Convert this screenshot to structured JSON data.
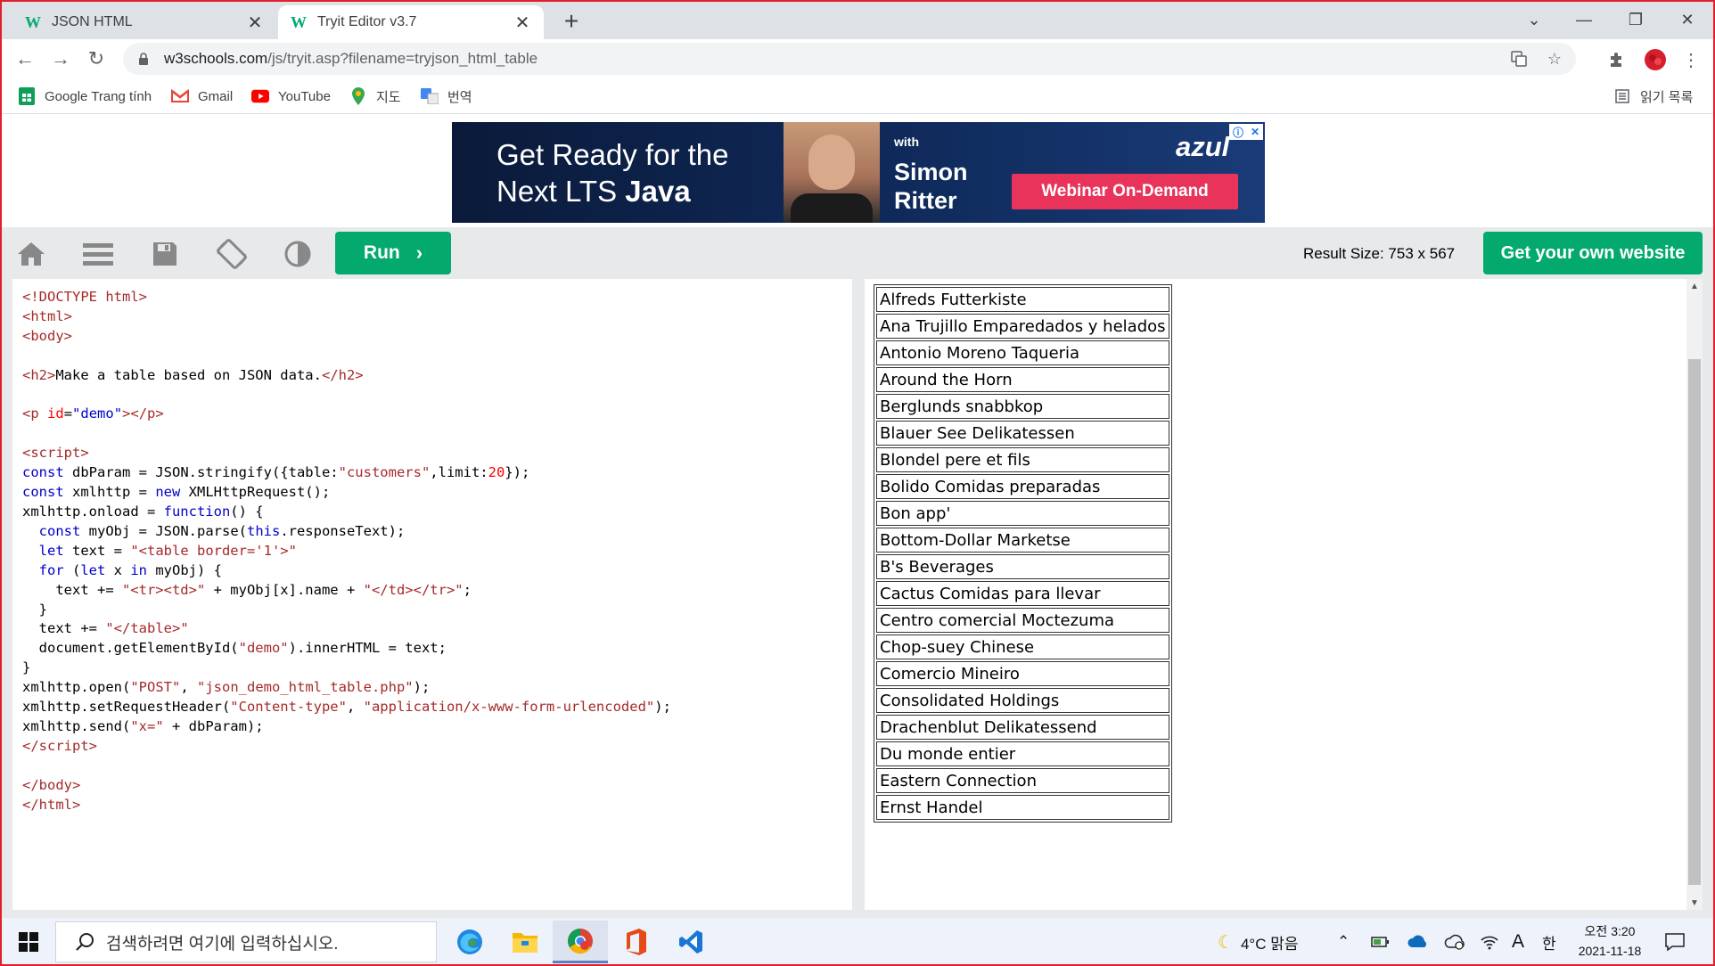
{
  "browser": {
    "tabs": [
      {
        "label": "JSON HTML",
        "active": false
      },
      {
        "label": "Tryit Editor v3.7",
        "active": true
      }
    ],
    "url_host": "w3schools.com",
    "url_path": "/js/tryit.asp?filename=tryjson_html_table",
    "bookmarks": [
      "Google Trang tính",
      "Gmail",
      "YouTube",
      "지도",
      "번역"
    ],
    "reading_list": "읽기 목록"
  },
  "ad": {
    "headline_line1": "Get Ready for the",
    "headline_line2_plain": "Next LTS ",
    "headline_line2_bold": "Java",
    "with": "with",
    "speaker_first": "Simon",
    "speaker_last": "Ritter",
    "brand": "azul",
    "cta": "Webinar On-Demand"
  },
  "tryit": {
    "run_label": "Run",
    "result_size_label": "Result Size: 753 x 567",
    "get_website_label": "Get your own website"
  },
  "result_table": {
    "rows": [
      "Alfreds Futterkiste",
      "Ana Trujillo Emparedados y helados",
      "Antonio Moreno Taqueria",
      "Around the Horn",
      "Berglunds snabbkop",
      "Blauer See Delikatessen",
      "Blondel pere et fils",
      "Bolido Comidas preparadas",
      "Bon app'",
      "Bottom-Dollar Marketse",
      "B's Beverages",
      "Cactus Comidas para llevar",
      "Centro comercial Moctezuma",
      "Chop-suey Chinese",
      "Comercio Mineiro",
      "Consolidated Holdings",
      "Drachenblut Delikatessend",
      "Du monde entier",
      "Eastern Connection",
      "Ernst Handel"
    ]
  },
  "taskbar": {
    "search_placeholder": "검색하려면 여기에 입력하십시오.",
    "weather": "4°C  맑음",
    "ime_a": "A",
    "ime_han": "한",
    "time": "오전 3:20",
    "date": "2021-11-18"
  },
  "colors": {
    "w3_green": "#04aa6d",
    "ad_cta": "#e8345a",
    "frame_red": "#e2202b"
  }
}
